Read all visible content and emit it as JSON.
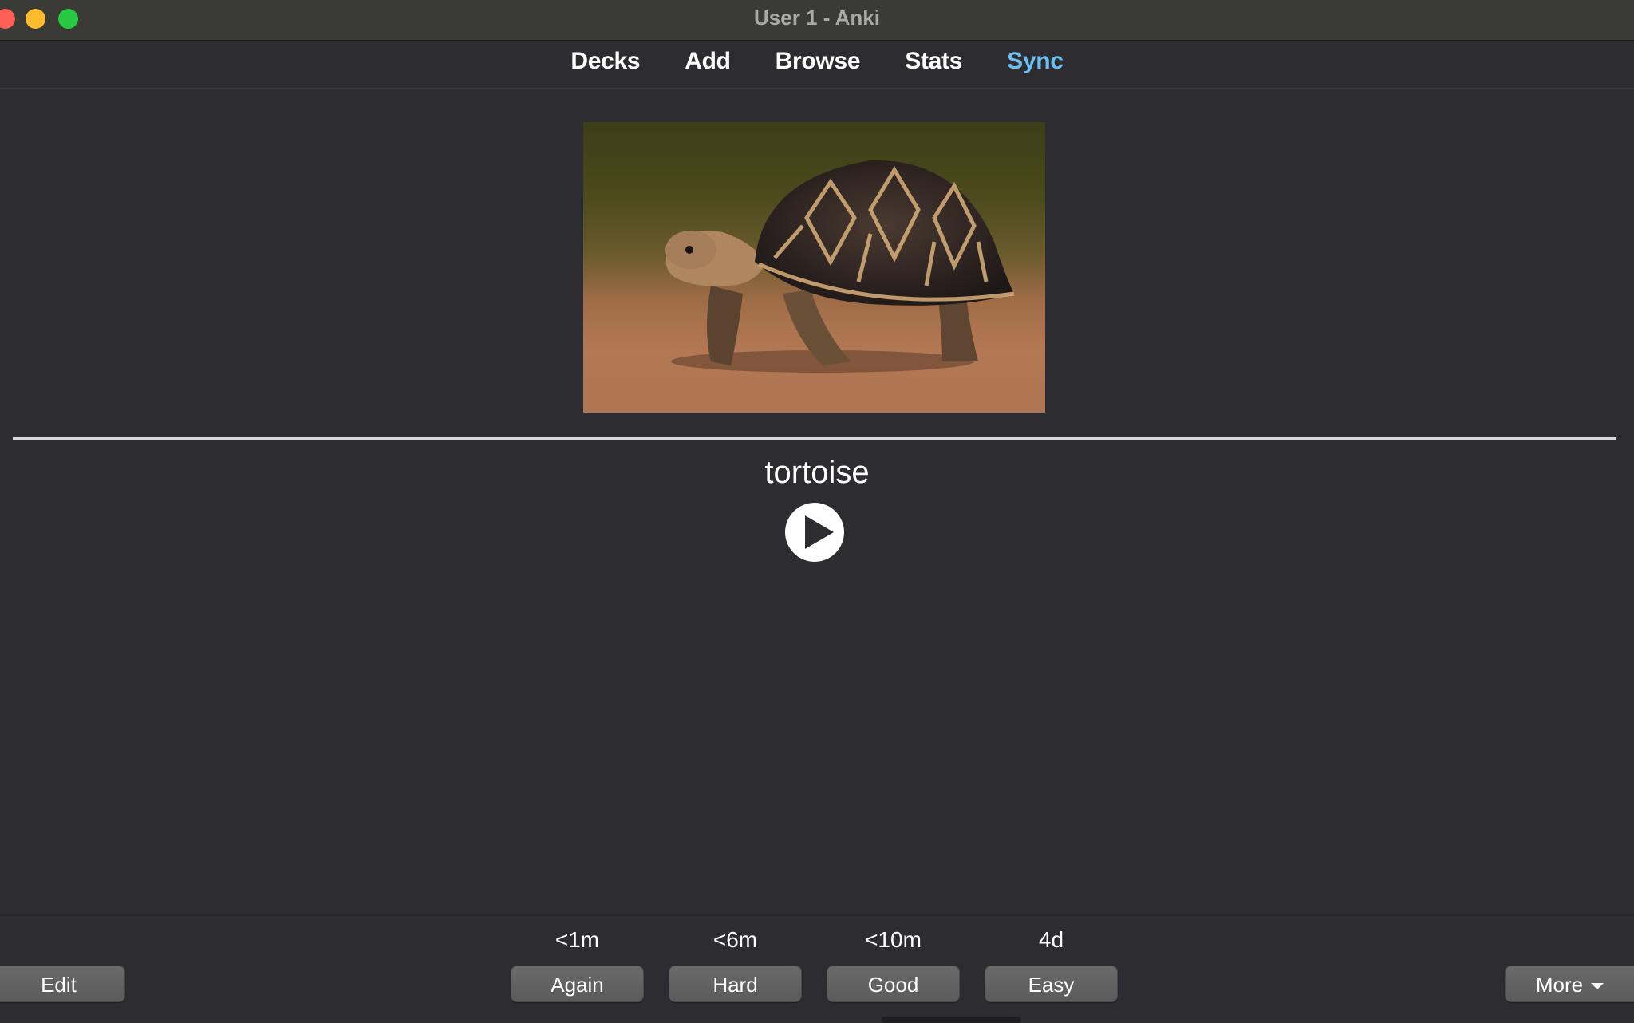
{
  "window": {
    "title": "User 1 - Anki"
  },
  "toolbar": {
    "items": [
      {
        "label": "Decks"
      },
      {
        "label": "Add"
      },
      {
        "label": "Browse"
      },
      {
        "label": "Stats"
      },
      {
        "label": "Sync"
      }
    ],
    "sync_color": "#6cbef0"
  },
  "card": {
    "image_alt": "star tortoise walking on sandy ground",
    "answer_word": "tortoise",
    "audio_icon": "play-icon"
  },
  "bottom": {
    "edit_label": "Edit",
    "more_label": "More",
    "answers": [
      {
        "interval": "<1m",
        "label": "Again"
      },
      {
        "interval": "<6m",
        "label": "Hard"
      },
      {
        "interval": "<10m",
        "label": "Good"
      },
      {
        "interval": "4d",
        "label": "Easy"
      }
    ]
  }
}
